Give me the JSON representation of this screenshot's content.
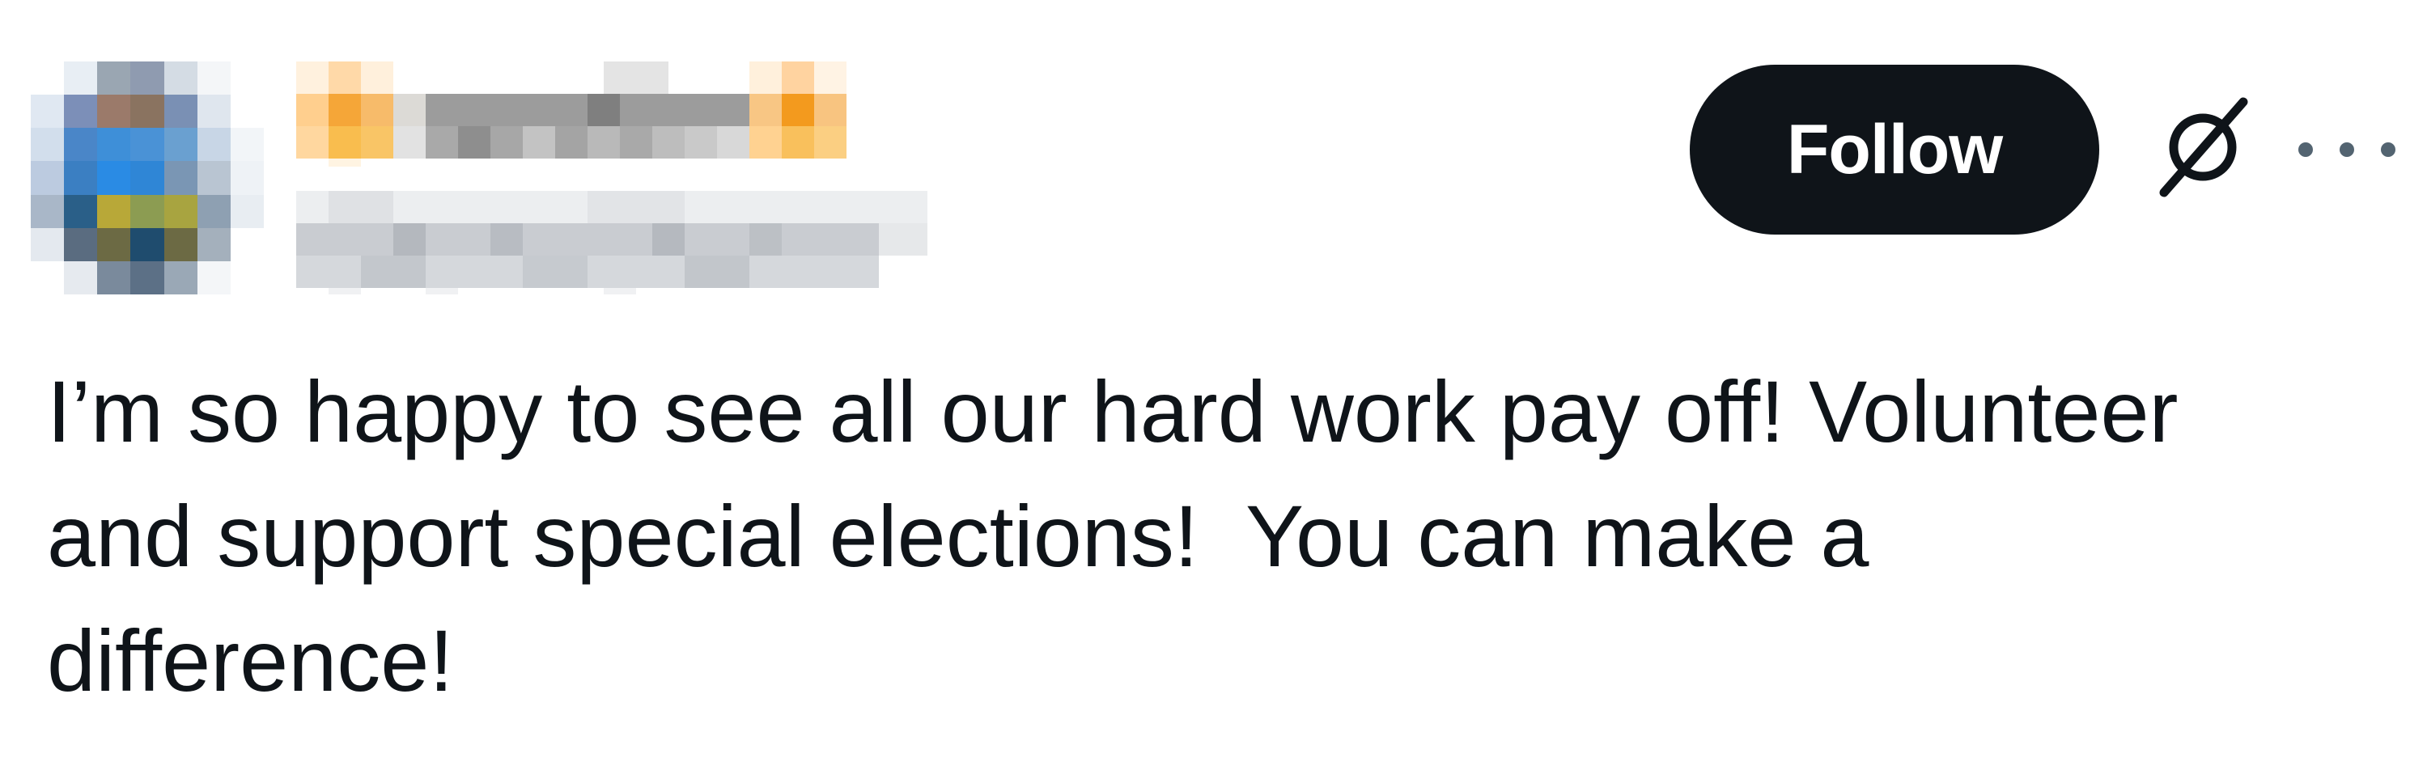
{
  "post": {
    "follow_label": "Follow",
    "text": "I’m so happy to see all our hard work pay off! Volunteer\nand support special elections!  You can make a\ndifference!",
    "icons": {
      "grok": "grok-icon",
      "more": "more-options-icon"
    }
  },
  "colors": {
    "text": "#0f1419",
    "button_bg": "#0f1419",
    "button_text": "#ffffff",
    "muted": "#536471"
  }
}
